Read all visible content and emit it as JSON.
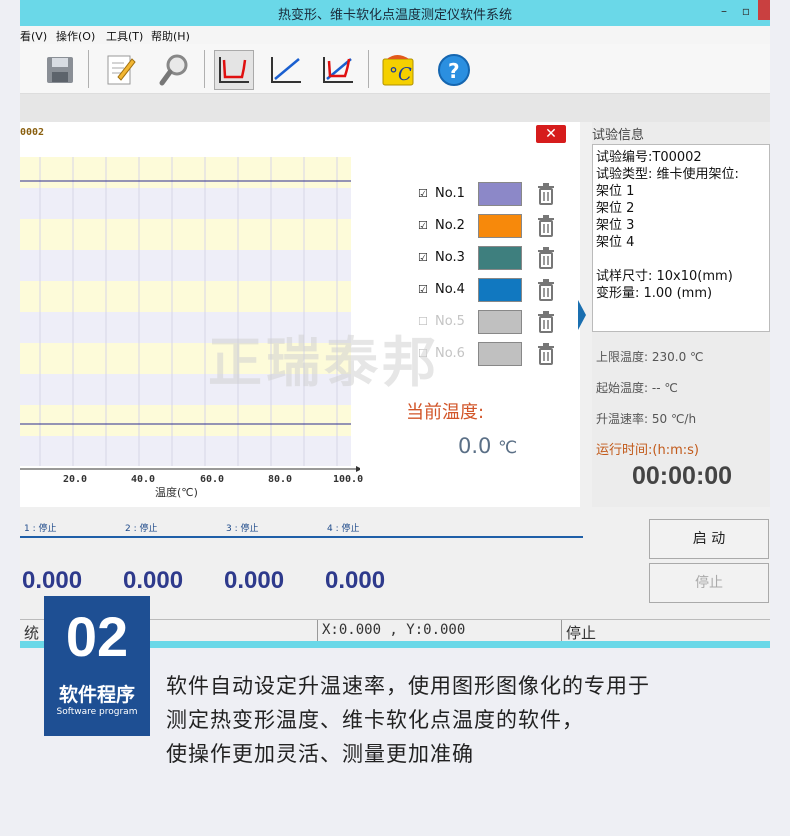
{
  "window": {
    "title": "热变形、维卡软化点温度测定仪软件系统"
  },
  "menu": {
    "items": [
      "看(V)",
      "操作(O)",
      "工具(T)",
      "帮助(H)"
    ]
  },
  "toolbar": {
    "icons": [
      "save-icon",
      "edit-icon",
      "search-icon",
      "curve-deformation-icon",
      "curve-temperature-icon",
      "curve-combined-icon",
      "temperature-icon",
      "help-icon"
    ]
  },
  "chart": {
    "test_id": "0002",
    "x_ticks": [
      "20.0",
      "40.0",
      "60.0",
      "80.0",
      "100.0"
    ],
    "x_label": "温度(℃)",
    "current_temp_label": "当前温度:",
    "current_temp_value": "0.0",
    "current_temp_unit": "℃",
    "watermark": "正瑞泰邦",
    "legend": [
      {
        "label": "No.1",
        "checked": true,
        "color": "#8c88c8",
        "enabled": true
      },
      {
        "label": "No.2",
        "checked": true,
        "color": "#f7890b",
        "enabled": true
      },
      {
        "label": "No.3",
        "checked": true,
        "color": "#3e7f7e",
        "enabled": true
      },
      {
        "label": "No.4",
        "checked": true,
        "color": "#1178c0",
        "enabled": true
      },
      {
        "label": "No.5",
        "checked": false,
        "color": "#c0c0c0",
        "enabled": false
      },
      {
        "label": "No.6",
        "checked": false,
        "color": "#c0c0c0",
        "enabled": false
      }
    ]
  },
  "info": {
    "section_title": "试验信息",
    "lines": [
      "试验编号:T00002",
      "试验类型: 维卡使用架位:",
      "架位 1",
      "架位 2",
      "架位 3",
      "架位 4",
      "",
      "试样尺寸: 10x10(mm)",
      "变形量: 1.00 (mm)"
    ],
    "upper_limit": "上限温度: 230.0 ℃",
    "start_temp": "起始温度: -- ℃",
    "heating_rate": "升温速率: 50 ℃/h",
    "runtime_label": "运行时间:(h:m:s)",
    "runtime_value": "00:00:00"
  },
  "stations": {
    "status": [
      "1 : 停止",
      "2 : 停止",
      "3 : 停止",
      "4 : 停止"
    ],
    "values": [
      "0.000",
      "0.000",
      "0.000",
      "0.000"
    ]
  },
  "buttons": {
    "start": "启 动",
    "stop": "停止"
  },
  "statusbar": {
    "left": "统",
    "coords": "X:0.000 , Y:0.000",
    "state": "停止"
  },
  "badge": {
    "number": "02",
    "title": "软件程序",
    "subtitle": "Software program"
  },
  "description": {
    "lines": [
      "软件自动设定升温速率，使用图形图像化的专用于",
      "测定热变形温度、维卡软化点温度的软件，",
      "使操作更加灵活、测量更加准确"
    ]
  }
}
